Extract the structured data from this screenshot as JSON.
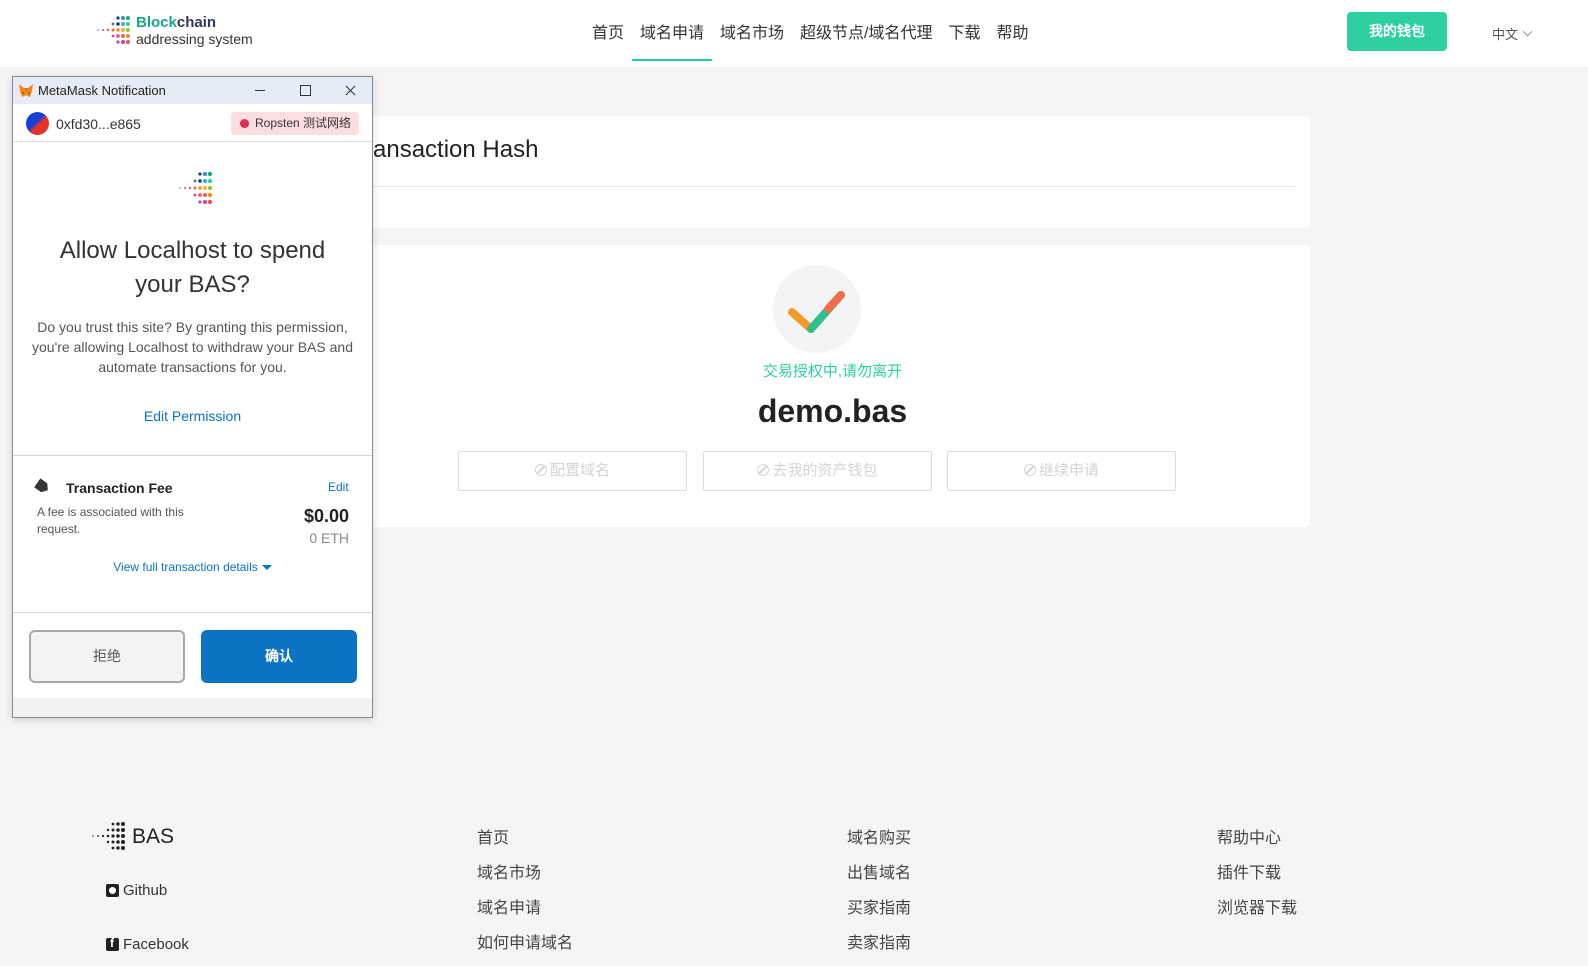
{
  "header": {
    "logo_line1_a": "Block",
    "logo_line1_b": "chain",
    "logo_line2": "addressing system",
    "nav": [
      "首页",
      "域名申请",
      "域名市场",
      "超级节点/域名代理",
      "下载",
      "帮助"
    ],
    "active_nav": "域名申请",
    "wallet_button": "我的钱包",
    "language": "中文"
  },
  "main": {
    "section_title": "ransaction Hash",
    "status_text": "交易授权中,请勿离开",
    "domain": "demo.bas",
    "actions": [
      "配置域名",
      "去我的资产钱包",
      "继续申请"
    ]
  },
  "footer": {
    "brand": "BAS",
    "social": [
      "Github",
      "Facebook"
    ],
    "col1": [
      "首页",
      "域名市场",
      "域名申请",
      "如何申请域名"
    ],
    "col2": [
      "域名购买",
      "出售域名",
      "买家指南",
      "卖家指南"
    ],
    "col3": [
      "帮助中心",
      "插件下载",
      "浏览器下载"
    ]
  },
  "metamask": {
    "window_title": "MetaMask Notification",
    "account": "0xfd30...e865",
    "network": "Ropsten 测试网络",
    "heading": "Allow Localhost to spend your BAS?",
    "description": "Do you trust this site? By granting this permission, you're allowing Localhost to withdraw your BAS and automate transactions for you.",
    "edit_permission": "Edit Permission",
    "fee_title": "Transaction Fee",
    "fee_edit": "Edit",
    "fee_desc": "A fee is associated with this request.",
    "fee_usd": "$0.00",
    "fee_eth": "0 ETH",
    "view_details": "View full transaction details",
    "reject": "拒绝",
    "confirm": "确认"
  },
  "colors": {
    "accent": "#2ed0a1",
    "metamask_blue": "#0a73c4"
  }
}
